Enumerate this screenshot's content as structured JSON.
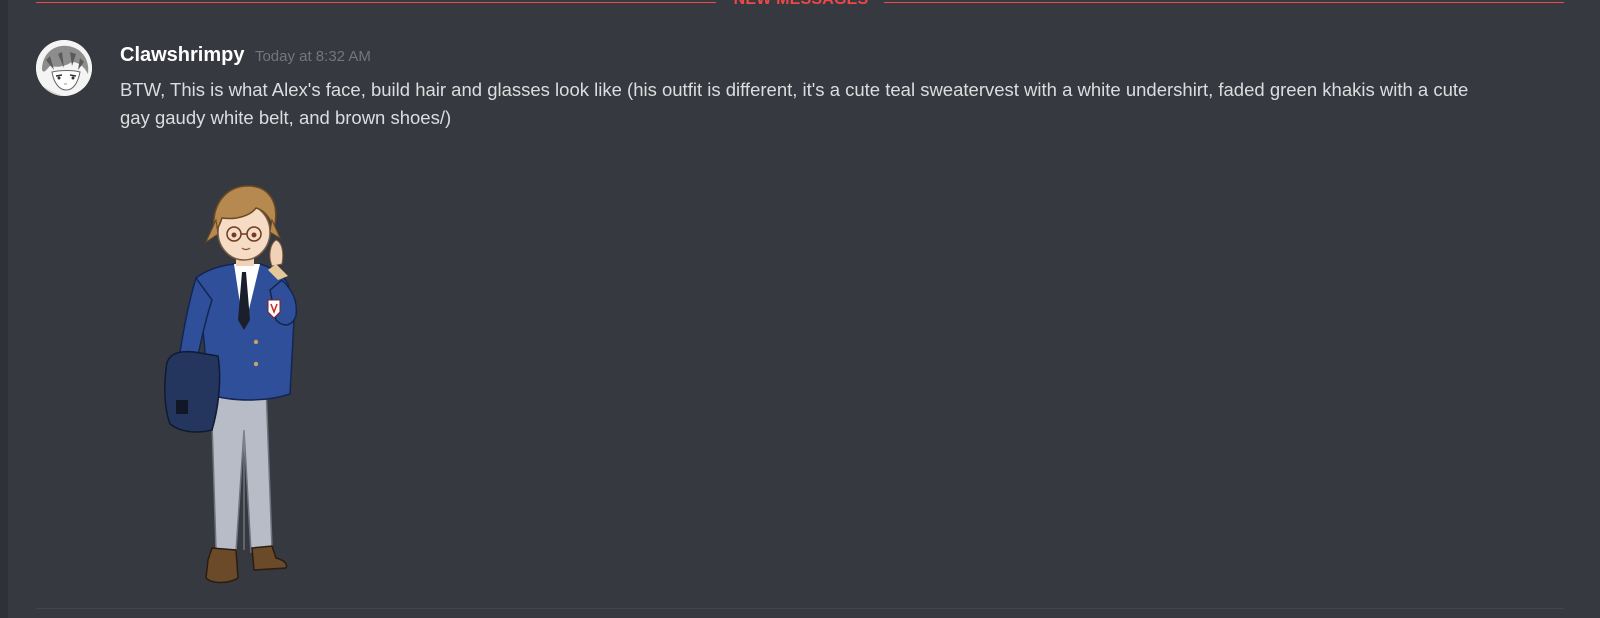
{
  "divider": {
    "label": "NEW MESSAGES",
    "color": "#f04747"
  },
  "message": {
    "author": "Clawshrimpy",
    "timestamp": "Today at 8:32 AM",
    "text": "BTW, This is what Alex's face, build hair and glasses look like (his outfit is different, it's a cute teal sweatervest with a white undershirt, faded green khakis with a cute gay gaudy white belt, and brown shoes/)",
    "avatar_icon": "manga-character-avatar",
    "attachment_icon": "anime-character-image"
  },
  "colors": {
    "background": "#36393f",
    "author": "#ffffff",
    "timestamp": "#72767d",
    "text": "#dcddde"
  }
}
